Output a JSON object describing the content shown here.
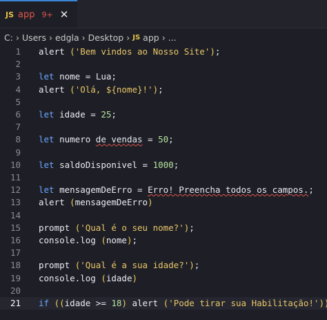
{
  "tab": {
    "badge": "JS",
    "name": "app",
    "modified": "9+",
    "close": "✕"
  },
  "breadcrumb": {
    "items": [
      "C:",
      "›",
      "Users",
      "›",
      "edgla",
      "›",
      "Desktop",
      "›"
    ],
    "js_badge": "JS",
    "file": "app",
    "tail": "› ..."
  },
  "editor": {
    "active_line": 21,
    "lines": [
      {
        "n": "1",
        "tokens": [
          [
            "t-id",
            "alert "
          ],
          [
            "t-br",
            "("
          ],
          [
            "t-str",
            "'Bem vindos ao Nosso Site'"
          ],
          [
            "t-br",
            ")"
          ],
          [
            "t-op",
            ";"
          ]
        ]
      },
      {
        "n": "2",
        "tokens": []
      },
      {
        "n": "3",
        "tokens": [
          [
            "t-kw",
            "let "
          ],
          [
            "t-id",
            "nome "
          ],
          [
            "t-op",
            "= "
          ],
          [
            "t-id",
            "Lua"
          ],
          [
            "t-op",
            ";"
          ]
        ]
      },
      {
        "n": "4",
        "tokens": [
          [
            "t-id",
            "alert "
          ],
          [
            "t-br",
            "("
          ],
          [
            "t-str",
            "'Olá, ${nome}!'"
          ],
          [
            "t-br",
            ")"
          ],
          [
            "t-op",
            ";"
          ]
        ]
      },
      {
        "n": "5",
        "tokens": []
      },
      {
        "n": "6",
        "tokens": [
          [
            "t-kw",
            "let "
          ],
          [
            "t-id",
            "idade "
          ],
          [
            "t-op",
            "= "
          ],
          [
            "t-num",
            "25"
          ],
          [
            "t-op",
            ";"
          ]
        ]
      },
      {
        "n": "7",
        "tokens": []
      },
      {
        "n": "8",
        "tokens": [
          [
            "t-kw",
            "let "
          ],
          [
            "t-id",
            "numero "
          ],
          [
            "t-id squiggle",
            "de vendas"
          ],
          [
            "t-op",
            " = "
          ],
          [
            "t-num",
            "50"
          ],
          [
            "t-op",
            ";"
          ]
        ]
      },
      {
        "n": "9",
        "tokens": []
      },
      {
        "n": "10",
        "tokens": [
          [
            "t-kw",
            "let "
          ],
          [
            "t-id",
            "saldoDisponivel "
          ],
          [
            "t-op",
            "= "
          ],
          [
            "t-num",
            "1000"
          ],
          [
            "t-op",
            ";"
          ]
        ]
      },
      {
        "n": "11",
        "tokens": []
      },
      {
        "n": "12",
        "tokens": [
          [
            "t-kw",
            "let "
          ],
          [
            "t-id",
            "mensagemDeErro "
          ],
          [
            "t-op",
            "= "
          ],
          [
            "t-id squiggle",
            "Erro! Preencha todos os campos."
          ],
          [
            "t-op",
            ";"
          ]
        ]
      },
      {
        "n": "13",
        "tokens": [
          [
            "t-id",
            "alert "
          ],
          [
            "t-br",
            "("
          ],
          [
            "t-id",
            "mensagemDeErro"
          ],
          [
            "t-br",
            ")"
          ]
        ]
      },
      {
        "n": "14",
        "tokens": []
      },
      {
        "n": "15",
        "tokens": [
          [
            "t-id",
            "prompt "
          ],
          [
            "t-br",
            "("
          ],
          [
            "t-str",
            "'Qual é o seu nome?'"
          ],
          [
            "t-br",
            ")"
          ],
          [
            "t-op",
            ";"
          ]
        ]
      },
      {
        "n": "16",
        "tokens": [
          [
            "t-id",
            "console.log "
          ],
          [
            "t-br",
            "("
          ],
          [
            "t-id",
            "nome"
          ],
          [
            "t-br",
            ")"
          ],
          [
            "t-op",
            ";"
          ]
        ]
      },
      {
        "n": "17",
        "tokens": []
      },
      {
        "n": "18",
        "tokens": [
          [
            "t-id",
            "prompt "
          ],
          [
            "t-br",
            "("
          ],
          [
            "t-str",
            "'Qual é a sua idade?'"
          ],
          [
            "t-br",
            ")"
          ],
          [
            "t-op",
            ";"
          ]
        ]
      },
      {
        "n": "19",
        "tokens": [
          [
            "t-id",
            "console.log "
          ],
          [
            "t-br",
            "("
          ],
          [
            "t-id",
            "idade"
          ],
          [
            "t-br",
            ")"
          ]
        ]
      },
      {
        "n": "20",
        "tokens": []
      },
      {
        "n": "21",
        "tokens": [
          [
            "t-kw",
            "if "
          ],
          [
            "t-br",
            "("
          ],
          [
            "t-br",
            "("
          ],
          [
            "t-id",
            "idade "
          ],
          [
            "t-op",
            ">= "
          ],
          [
            "t-num",
            "18"
          ],
          [
            "t-br",
            ") "
          ],
          [
            "t-id",
            "alert "
          ],
          [
            "t-br",
            "("
          ],
          [
            "t-str",
            "'Pode tirar sua Habilitação!'"
          ],
          [
            "t-br",
            ")"
          ],
          [
            "t-br",
            ")"
          ],
          [
            "t-op",
            ";"
          ]
        ]
      }
    ]
  },
  "colors": {
    "background": "#1e1f26",
    "keyword": "#6aa6ff",
    "string": "#e8c66a",
    "number": "#b6e3a1",
    "error": "#e0554e"
  }
}
